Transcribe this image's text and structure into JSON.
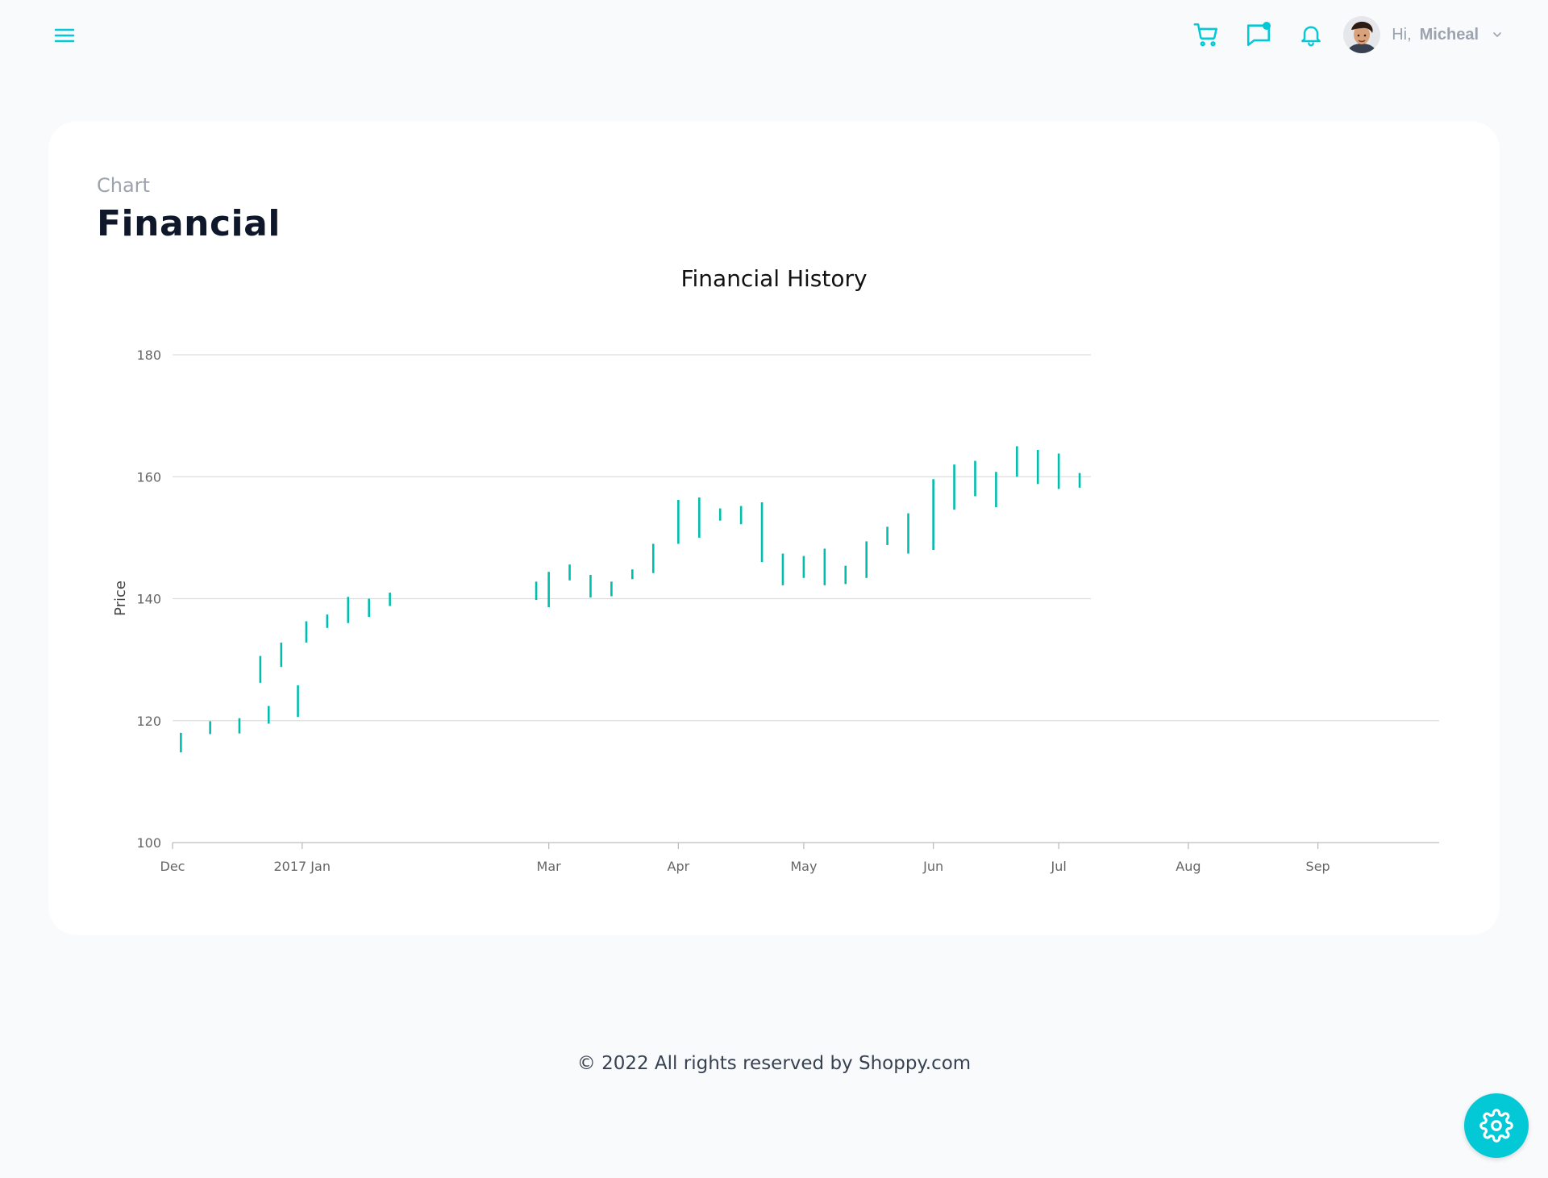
{
  "header": {
    "greeting": "Hi,",
    "user_name": "Micheal",
    "icons": [
      "menu-icon",
      "cart-icon",
      "chat-icon",
      "notification-icon",
      "chevron-down-icon"
    ],
    "accent": "#03c9d7"
  },
  "page": {
    "breadcrumb": "Chart",
    "title": "Financial"
  },
  "chart_data": {
    "type": "hilo",
    "title": "Financial History",
    "xlabel": "",
    "ylabel": "Price",
    "ylim": [
      100,
      180
    ],
    "yticks": [
      100,
      120,
      140,
      160,
      180
    ],
    "xlim": [
      "2016-12-01",
      "2017-09-30"
    ],
    "xticks": [
      {
        "date": "2016-12-01",
        "label": "Dec"
      },
      {
        "date": "2017-01-01",
        "label": "2017 Jan"
      },
      {
        "date": "2017-03-01",
        "label": "Mar"
      },
      {
        "date": "2017-04-01",
        "label": "Apr"
      },
      {
        "date": "2017-05-01",
        "label": "May"
      },
      {
        "date": "2017-06-01",
        "label": "Jun"
      },
      {
        "date": "2017-07-01",
        "label": "Jul"
      },
      {
        "date": "2017-08-01",
        "label": "Aug"
      },
      {
        "date": "2017-09-01",
        "label": "Sep"
      }
    ],
    "grid": true,
    "color": "#00bdae",
    "series": [
      {
        "points": [
          {
            "x": "2016-12-03",
            "low": 114.8,
            "high": 118.0
          },
          {
            "x": "2016-12-10",
            "low": 117.8,
            "high": 119.9
          },
          {
            "x": "2016-12-17",
            "low": 117.9,
            "high": 120.4
          },
          {
            "x": "2016-12-24",
            "low": 119.5,
            "high": 122.4
          },
          {
            "x": "2016-12-22",
            "low": 126.2,
            "high": 130.6
          },
          {
            "x": "2016-12-27",
            "low": 128.8,
            "high": 132.8
          },
          {
            "x": "2016-12-31",
            "low": 120.6,
            "high": 125.8
          },
          {
            "x": "2017-01-02",
            "low": 132.8,
            "high": 136.3
          },
          {
            "x": "2017-01-07",
            "low": 135.2,
            "high": 137.4
          },
          {
            "x": "2017-01-12",
            "low": 136.0,
            "high": 140.3
          },
          {
            "x": "2017-01-17",
            "low": 137.0,
            "high": 140.0
          },
          {
            "x": "2017-01-22",
            "low": 138.8,
            "high": 141.0
          },
          {
            "x": "2017-02-26",
            "low": 139.8,
            "high": 142.8
          },
          {
            "x": "2017-03-01",
            "low": 138.6,
            "high": 144.4
          },
          {
            "x": "2017-03-06",
            "low": 143.0,
            "high": 145.6
          },
          {
            "x": "2017-03-11",
            "low": 140.2,
            "high": 143.9
          },
          {
            "x": "2017-03-16",
            "low": 140.4,
            "high": 142.8
          },
          {
            "x": "2017-03-21",
            "low": 143.2,
            "high": 144.8
          },
          {
            "x": "2017-03-26",
            "low": 144.2,
            "high": 149.0
          },
          {
            "x": "2017-04-01",
            "low": 149.0,
            "high": 156.2
          },
          {
            "x": "2017-04-06",
            "low": 150.0,
            "high": 156.6
          },
          {
            "x": "2017-04-11",
            "low": 152.8,
            "high": 154.8
          },
          {
            "x": "2017-04-16",
            "low": 152.2,
            "high": 155.2
          },
          {
            "x": "2017-04-21",
            "low": 146.0,
            "high": 155.8
          },
          {
            "x": "2017-04-26",
            "low": 142.2,
            "high": 147.4
          },
          {
            "x": "2017-05-01",
            "low": 143.4,
            "high": 147.0
          },
          {
            "x": "2017-05-06",
            "low": 142.2,
            "high": 148.2
          },
          {
            "x": "2017-05-11",
            "low": 142.4,
            "high": 145.4
          },
          {
            "x": "2017-05-16",
            "low": 143.4,
            "high": 149.4
          },
          {
            "x": "2017-05-21",
            "low": 148.8,
            "high": 151.8
          },
          {
            "x": "2017-05-26",
            "low": 147.4,
            "high": 154.0
          },
          {
            "x": "2017-06-01",
            "low": 148.0,
            "high": 159.6
          },
          {
            "x": "2017-06-06",
            "low": 154.6,
            "high": 162.0
          },
          {
            "x": "2017-06-11",
            "low": 156.8,
            "high": 162.6
          },
          {
            "x": "2017-06-16",
            "low": 155.0,
            "high": 160.8
          },
          {
            "x": "2017-06-21",
            "low": 160.0,
            "high": 165.0
          },
          {
            "x": "2017-06-26",
            "low": 158.8,
            "high": 164.4
          },
          {
            "x": "2017-07-01",
            "low": 158.0,
            "high": 163.8
          },
          {
            "x": "2017-07-06",
            "low": 158.2,
            "high": 160.6
          }
        ]
      }
    ]
  },
  "footer": {
    "text": "© 2022 All rights reserved by Shoppy.com"
  }
}
